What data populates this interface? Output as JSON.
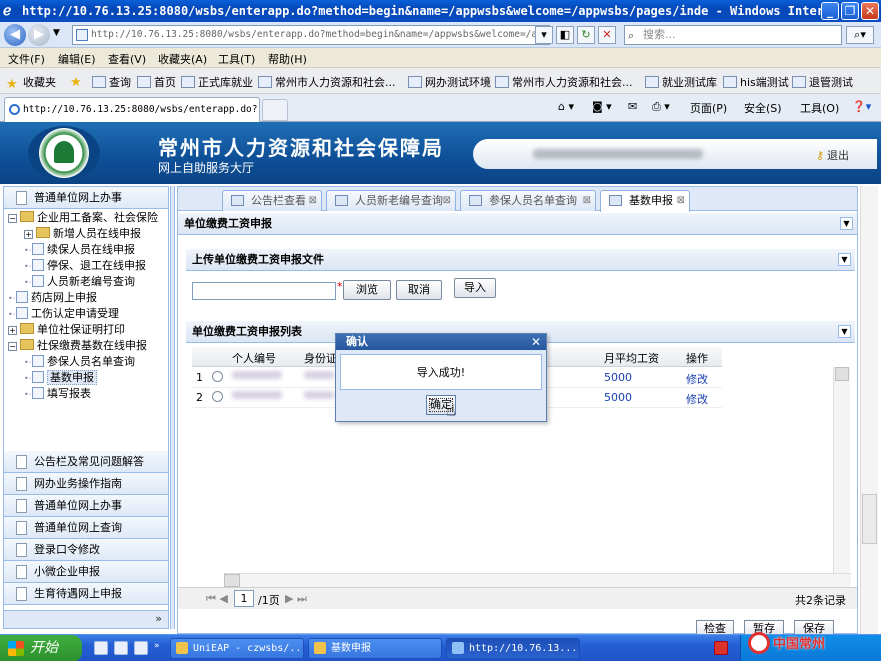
{
  "browser": {
    "window_title": "http://10.76.13.25:8080/wsbs/enterapp.do?method=begin&name=/appwsbs&welcome=/appwsbs/pages/inde - Windows Interne...",
    "address": "http://10.76.13.25:8080/wsbs/enterapp.do?method=begin&name=/appwsbs&welcome=/appwsbs/",
    "search_placeholder": "搜索...",
    "menu": [
      "文件(F)",
      "编辑(E)",
      "查看(V)",
      "收藏夹(A)",
      "工具(T)",
      "帮助(H)"
    ],
    "favorites_label": "收藏夹",
    "favorites": [
      "查询",
      "首页",
      "正式库就业",
      "常州市人力资源和社会...",
      "网办测试环境",
      "常州市人力资源和社会...",
      "就业测试库",
      "his端测试",
      "退管测试"
    ],
    "tab_title": "http://10.76.13.25:8080/wsbs/enterapp.do?...",
    "commands": [
      "页面(P)",
      "安全(S)",
      "工具(O)"
    ]
  },
  "site": {
    "title": "常州市人力资源和社会保障局",
    "subtitle": "网上自助服务大厅",
    "logout": "退出"
  },
  "sidebar": {
    "top_section": "普通单位网上办事",
    "tree": [
      {
        "label": "企业用工备案、社会保险",
        "level": 0,
        "type": "folder",
        "expanded": true
      },
      {
        "label": "新增人员在线申报",
        "level": 1,
        "type": "folder",
        "expanded": false
      },
      {
        "label": "续保人员在线申报",
        "level": 1,
        "type": "file"
      },
      {
        "label": "停保、退工在线申报",
        "level": 1,
        "type": "file"
      },
      {
        "label": "人员新老编号查询",
        "level": 1,
        "type": "file"
      },
      {
        "label": "药店网上申报",
        "level": 0,
        "type": "file"
      },
      {
        "label": "工伤认定申请受理",
        "level": 0,
        "type": "file"
      },
      {
        "label": "单位社保证明打印",
        "level": 0,
        "type": "folder",
        "expanded": false
      },
      {
        "label": "社保缴费基数在线申报",
        "level": 0,
        "type": "folder",
        "expanded": true
      },
      {
        "label": "参保人员名单查询",
        "level": 1,
        "type": "file"
      },
      {
        "label": "基数申报",
        "level": 1,
        "type": "file",
        "selected": true
      },
      {
        "label": "填写报表",
        "level": 1,
        "type": "file"
      }
    ],
    "sections": [
      "公告栏及常见问题解答",
      "网办业务操作指南",
      "普通单位网上办事",
      "普通单位网上查询",
      "登录口令修改",
      "小微企业申报",
      "生育待遇网上申报"
    ],
    "collapse": "»"
  },
  "tabs": [
    {
      "label": "公告栏查看",
      "active": false
    },
    {
      "label": "人员新老编号查询",
      "active": false
    },
    {
      "label": "参保人员名单查询",
      "active": false
    },
    {
      "label": "基数申报",
      "active": true
    }
  ],
  "form": {
    "panel_title": "单位缴费工资申报",
    "upload_title": "上传单位缴费工资申报文件",
    "browse": "浏览",
    "cancel": "取消",
    "import": "导入",
    "list_title": "单位缴费工资申报列表"
  },
  "grid": {
    "columns": [
      "个人编号",
      "身份证",
      "月平均工资",
      "操作"
    ],
    "rows": [
      {
        "index": "1",
        "salary": "5000",
        "action": "修改"
      },
      {
        "index": "2",
        "salary": "5000",
        "action": "修改"
      }
    ]
  },
  "pager": {
    "page": "1",
    "total_pages": "/1页",
    "summary": "共2条记录"
  },
  "bottom_buttons": [
    "检查",
    "暂存",
    "保存"
  ],
  "dialog": {
    "title": "确认",
    "message": "导入成功!",
    "ok": "确定"
  },
  "taskbar": {
    "start": "开始",
    "tasks": [
      "UniEAP - czwsbs/...",
      "基数申报",
      "http://10.76.13...."
    ],
    "watermark": "中国常州"
  }
}
